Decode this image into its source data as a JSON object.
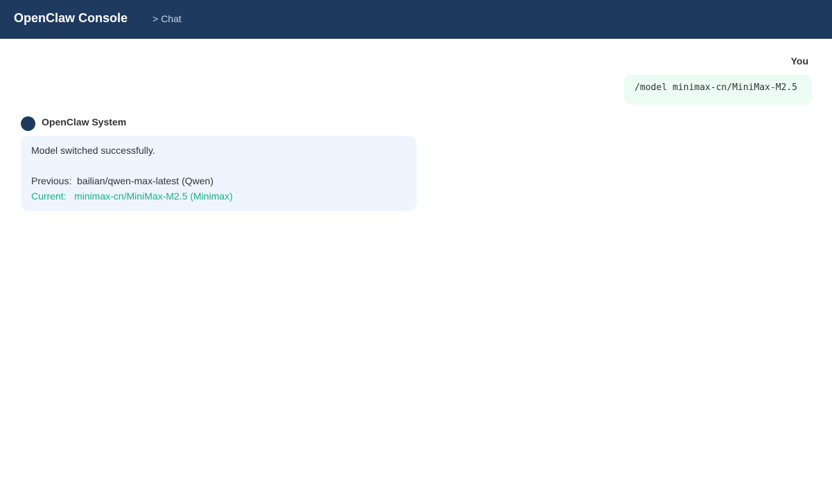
{
  "header": {
    "title": "OpenClaw Console",
    "breadcrumb": "> Chat"
  },
  "user_message": {
    "sender": "You",
    "text": "/model minimax-cn/MiniMax-M2.5"
  },
  "system_message": {
    "sender": "OpenClaw System",
    "status": "Model switched successfully.",
    "previous_label": "Previous:",
    "previous_value": "bailian/qwen-max-latest (Qwen)",
    "current_label": "Current:",
    "current_value": "minimax-cn/MiniMax-M2.5 (Minimax)"
  },
  "colors": {
    "header_bg": "#1e3a5f",
    "user_bubble_bg": "#ecfbf4",
    "system_bubble_bg": "#eef5fe",
    "current_accent": "#19b088"
  }
}
